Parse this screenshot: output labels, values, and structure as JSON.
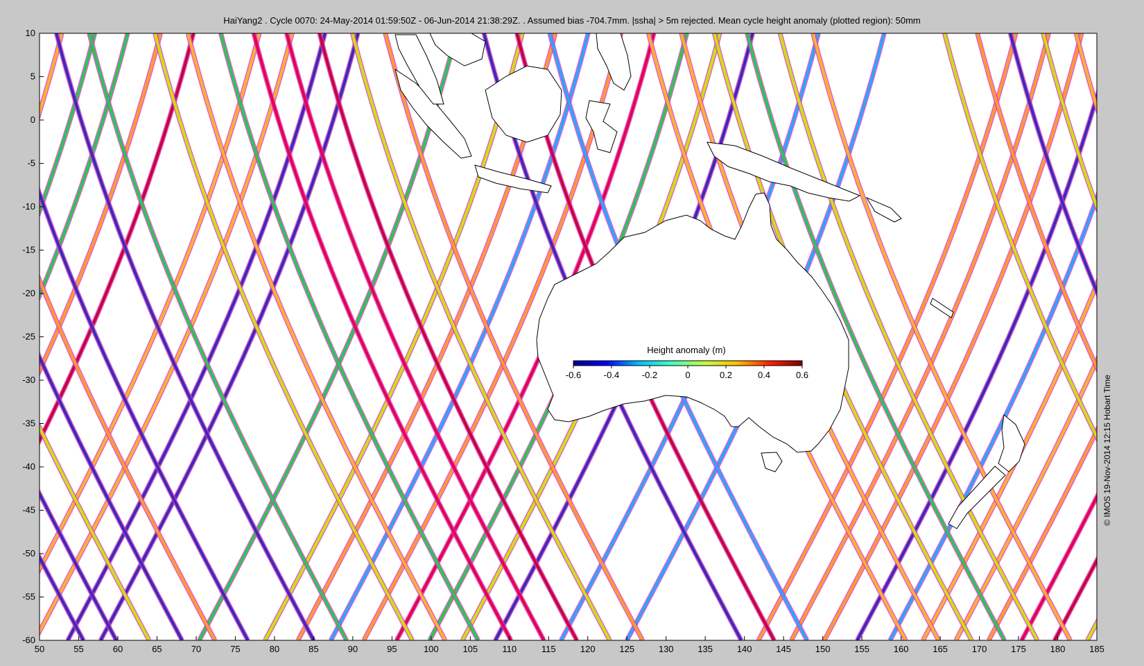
{
  "title": "HaiYang2 . Cycle 0070: 24-May-2014 01:59:50Z - 06-Jun-2014 21:38:29Z. . Assumed bias -704.7mm.  |ssha| > 5m rejected.  Mean cycle height anomaly (plotted region): 50mm",
  "credit": "© IMOS 19-Nov-2014 12:15 Hobart Time",
  "map": {
    "lon_range": [
      50,
      185
    ],
    "lat_range": [
      -60,
      10
    ],
    "x_ticks": [
      "50",
      "55",
      "60",
      "65",
      "70",
      "75",
      "80",
      "85",
      "90",
      "95",
      "100",
      "105",
      "110",
      "115",
      "120",
      "125",
      "130",
      "135",
      "140",
      "145",
      "150",
      "155",
      "160",
      "165",
      "170",
      "175",
      "180",
      "185"
    ],
    "y_ticks": [
      "10",
      "5",
      "0",
      "-5",
      "-10",
      "-15",
      "-20",
      "-25",
      "-30",
      "-35",
      "-40",
      "-45",
      "-50",
      "-55",
      "-60"
    ],
    "background": "#ffffff",
    "track_outline": "#d43fbf"
  },
  "colorbar": {
    "title": "Height anomaly (m)",
    "ticks": [
      "-0.6",
      "-0.4",
      "-0.2",
      "0",
      "0.2",
      "0.4",
      "0.6"
    ],
    "range": [
      -0.6,
      0.6
    ],
    "colors": [
      "#00008f",
      "#0000ff",
      "#00bfff",
      "#40ffbf",
      "#bfff40",
      "#ffbf00",
      "#ff2000",
      "#800000"
    ]
  }
}
